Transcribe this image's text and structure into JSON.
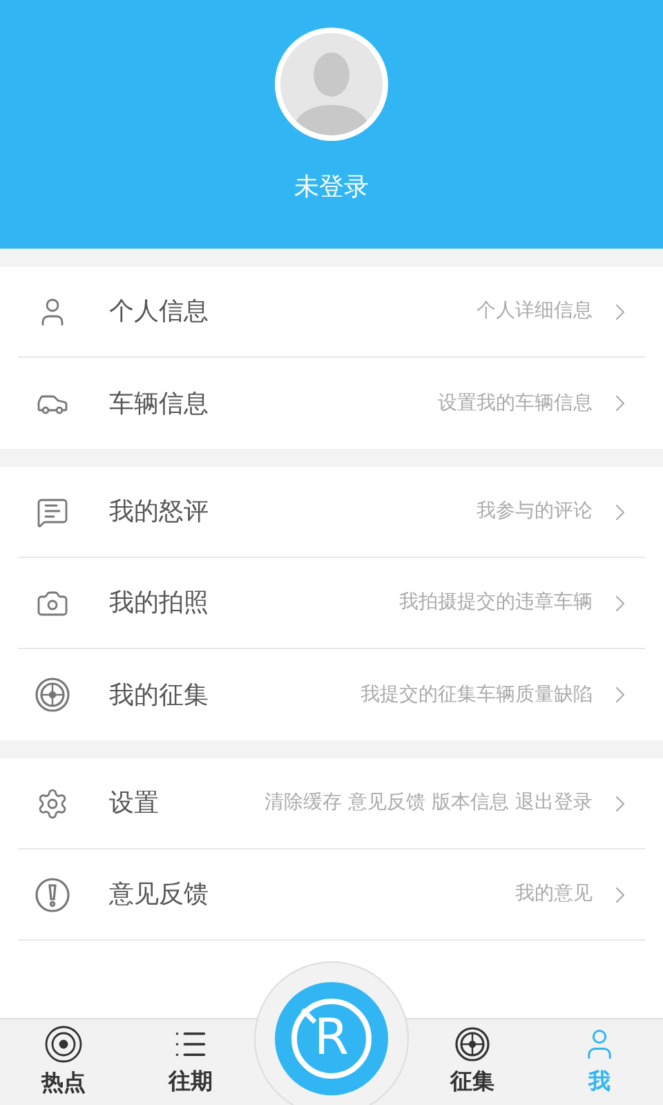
{
  "profile": {
    "name": "未登录"
  },
  "menu_groups": [
    {
      "items": [
        {
          "label": "个人信息",
          "detail": "个人详细信息"
        },
        {
          "label": "车辆信息",
          "detail": "设置我的车辆信息"
        }
      ]
    },
    {
      "items": [
        {
          "label": "我的怒评",
          "detail": "我参与的评论"
        },
        {
          "label": "我的拍照",
          "detail": "我拍摄提交的违章车辆"
        },
        {
          "label": "我的征集",
          "detail": "我提交的征集车辆质量缺陷"
        }
      ]
    },
    {
      "items": [
        {
          "label": "设置",
          "detail": "清除缓存 意见反馈 版本信息 退出登录"
        },
        {
          "label": "意见反馈",
          "detail": "我的意见"
        }
      ]
    }
  ],
  "bottom_nav": [
    {
      "kind": "tab",
      "label": "热点",
      "selected": false
    },
    {
      "kind": "tab",
      "label": "往期",
      "selected": false
    },
    {
      "kind": "center",
      "label": "R"
    },
    {
      "kind": "tab",
      "label": "征集",
      "selected": false
    },
    {
      "kind": "tab",
      "label": "我",
      "selected": true
    }
  ]
}
